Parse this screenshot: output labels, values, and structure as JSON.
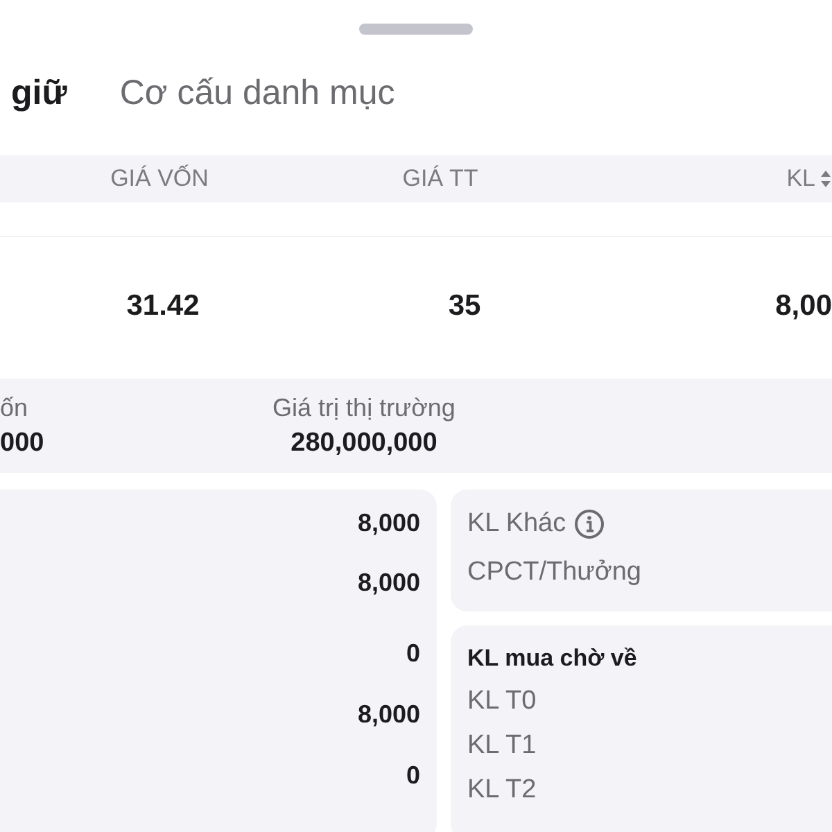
{
  "tabs": [
    {
      "label": "giữ",
      "selected": true
    },
    {
      "label": "Cơ cấu danh mục",
      "selected": false
    }
  ],
  "table": {
    "columns": [
      {
        "label": "GIÁ VỐN",
        "kind": "plain"
      },
      {
        "label": "GIÁ TT",
        "kind": "plain"
      },
      {
        "label": "KL",
        "kind": "sortable"
      }
    ],
    "rows": [
      [
        "31.42",
        "35",
        "8,00"
      ]
    ]
  },
  "summary": [
    {
      "label": "ốn",
      "value": "000"
    },
    {
      "label": "Giá trị thị trường",
      "value": "280,000,000"
    }
  ],
  "volumes": [
    "8,000",
    "8,000",
    "0",
    "8,000",
    "0"
  ],
  "other_card": {
    "items": [
      {
        "label": "KL Khác",
        "kind": "with_info"
      },
      {
        "label": "CPCT/Thưởng",
        "kind": "plain"
      }
    ]
  },
  "pending_card": {
    "title": "KL mua chờ về",
    "items": [
      "KL T0",
      "KL T1",
      "KL T2"
    ]
  }
}
